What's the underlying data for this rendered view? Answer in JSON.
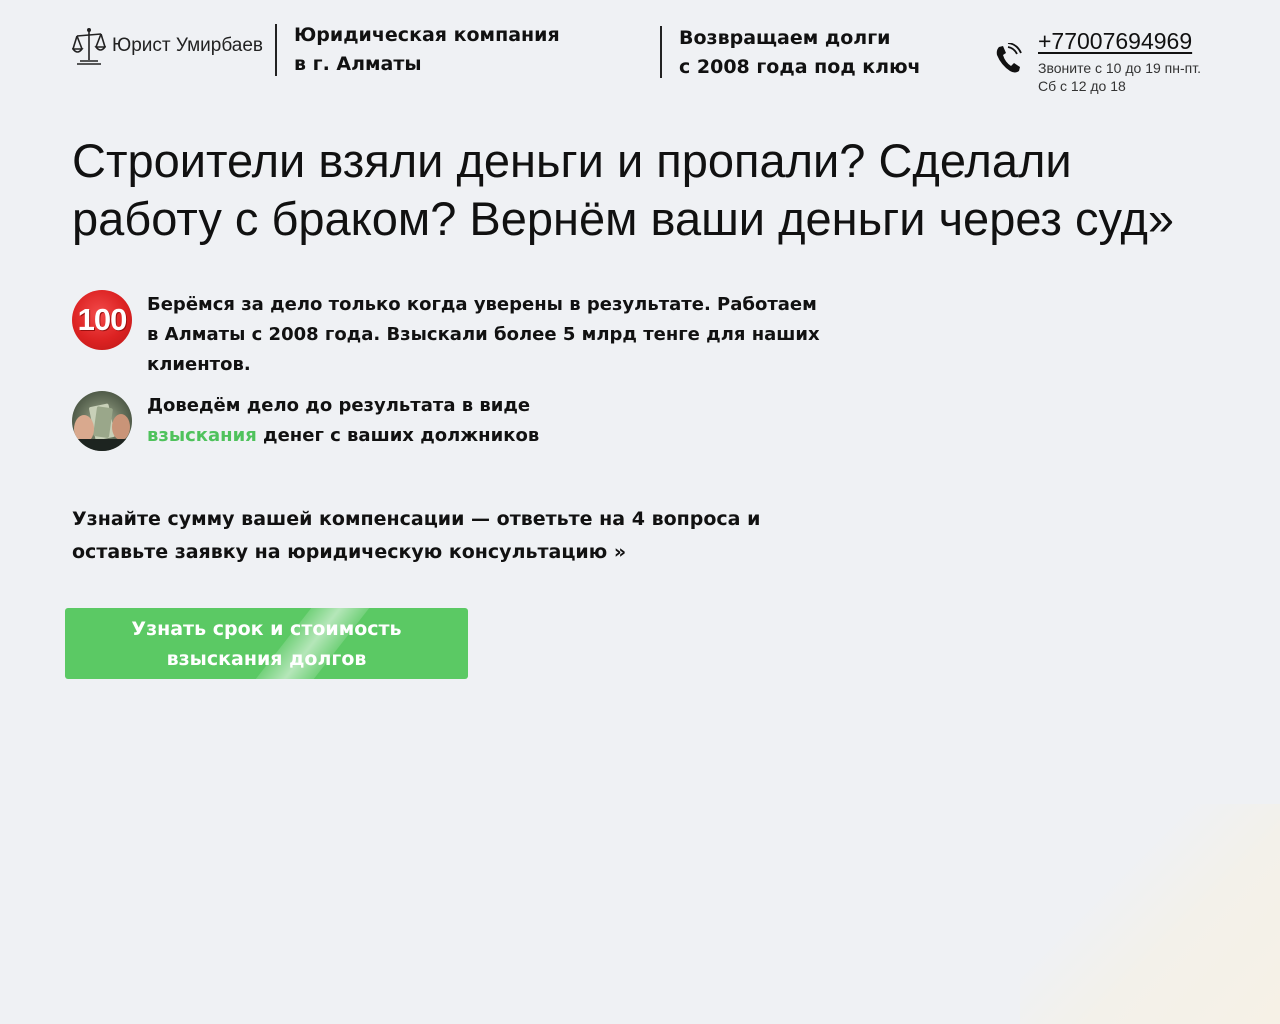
{
  "header": {
    "logo_text": "Юрист Умирбаев",
    "company_line1": "Юридическая компания",
    "company_line2": "в г. Алматы",
    "slogan_line1": "Возвращаем долги",
    "slogan_line2": "с 2008 года под ключ",
    "phone": "+77007694969",
    "hours_line1": "Звоните с 10 до 19 пн-пт.",
    "hours_line2": "Сб с 12 до 18"
  },
  "hero": {
    "headline_line1": "Строители взяли деньги и пропали? Сделали",
    "headline_line2": "работу с браком? Вернём ваши деньги через суд»"
  },
  "features": [
    {
      "icon": "100-badge-icon",
      "badge_text": "100",
      "line1": "Берёмся за дело только когда уверены в результате. Работаем",
      "line2": "в Алматы с 2008 года. Взыскали более 5 млрд тенге для наших",
      "line3": "клиентов."
    },
    {
      "icon": "money-hands-icon",
      "line1": "Доведём дело до результата в виде",
      "line2_accent": "взыскания",
      "line2_rest": " денег с ваших должников"
    }
  ],
  "cta": {
    "text_line1": "Узнайте сумму вашей компенсации — ответьте на 4 вопроса и",
    "text_line2": "оставьте заявку на юридическую консультацию »",
    "button_line1": "Узнать срок и стоимость",
    "button_line2": "взыскания долгов"
  },
  "colors": {
    "background": "#eff1f4",
    "accent_green": "#5bc964",
    "badge_red": "#dc2222"
  }
}
